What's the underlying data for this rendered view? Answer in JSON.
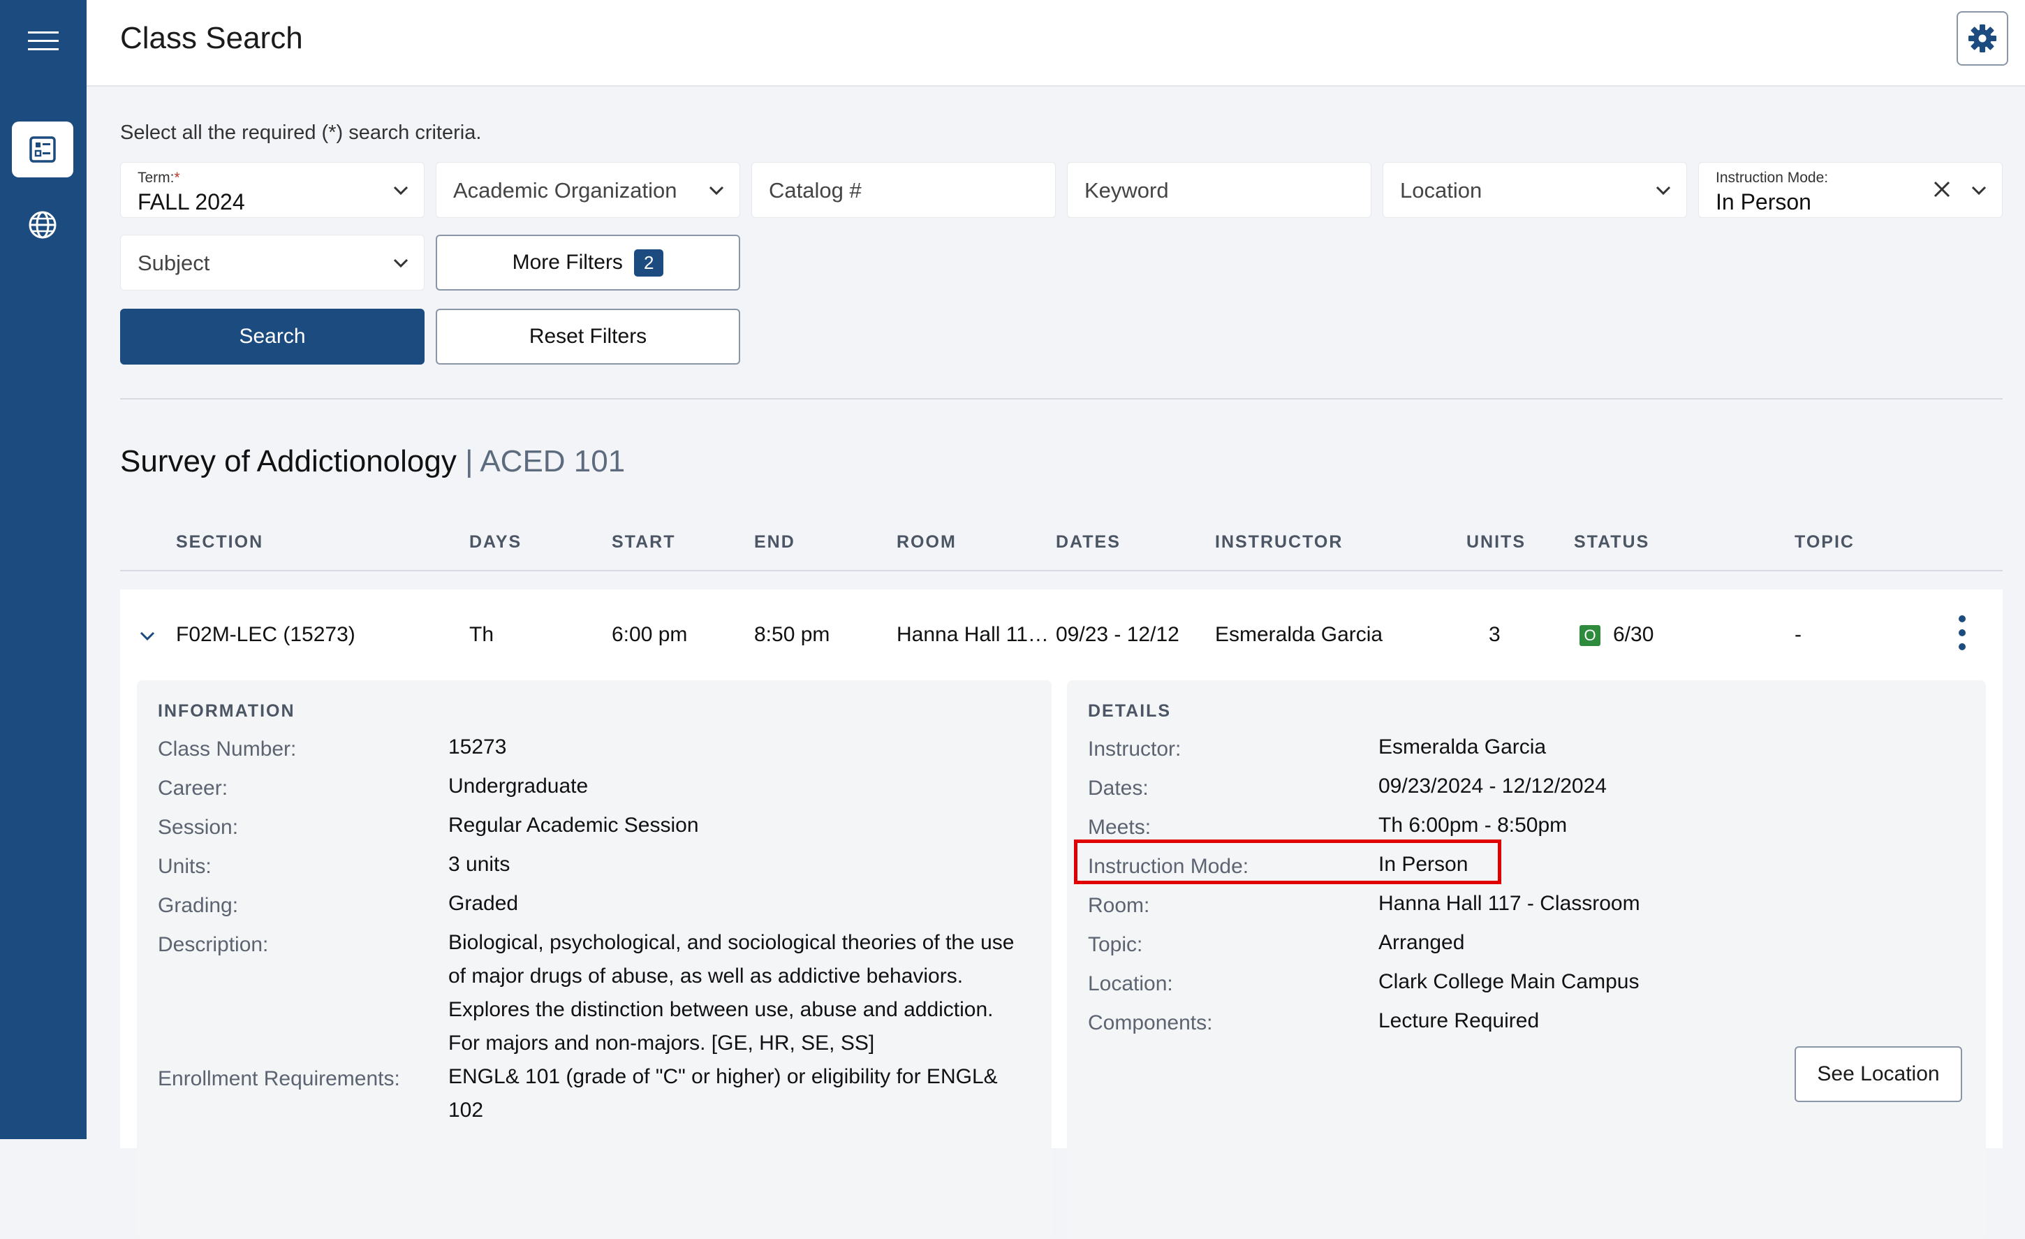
{
  "header": {
    "title": "Class Search"
  },
  "search": {
    "instructions": "Select all the required (*) search criteria.",
    "term": {
      "label": "Term:",
      "required_mark": "*",
      "value": "FALL 2024"
    },
    "academic_org": {
      "placeholder": "Academic Organization"
    },
    "catalog": {
      "placeholder": "Catalog #"
    },
    "keyword": {
      "placeholder": "Keyword"
    },
    "location": {
      "placeholder": "Location"
    },
    "instruction_mode": {
      "label": "Instruction Mode:",
      "value": "In Person"
    },
    "subject": {
      "placeholder": "Subject"
    },
    "more_filters": {
      "label": "More Filters",
      "count": "2"
    },
    "search_button": "Search",
    "reset_button": "Reset Filters"
  },
  "course": {
    "title": "Survey of Addictionology",
    "separator": "|",
    "code": "ACED 101"
  },
  "columns": [
    "SECTION",
    "DAYS",
    "START",
    "END",
    "ROOM",
    "DATES",
    "INSTRUCTOR",
    "UNITS",
    "STATUS",
    "TOPIC"
  ],
  "section_row": {
    "section": "F02M-LEC (15273)",
    "days": "Th",
    "start": "6:00 pm",
    "end": "8:50 pm",
    "room": "Hanna Hall 11…",
    "dates": "09/23 - 12/12",
    "instructor": "Esmeralda Garcia",
    "units": "3",
    "status_badge": "O",
    "status": "6/30",
    "topic": "-"
  },
  "information": {
    "title": "INFORMATION",
    "class_number": {
      "label": "Class Number:",
      "value": "15273"
    },
    "career": {
      "label": "Career:",
      "value": "Undergraduate"
    },
    "session": {
      "label": "Session:",
      "value": "Regular Academic Session"
    },
    "units": {
      "label": "Units:",
      "value": "3 units"
    },
    "grading": {
      "label": "Grading:",
      "value": "Graded"
    },
    "description": {
      "label": "Description:",
      "lines": [
        "Biological, psychological, and sociological theories of the use",
        "of major drugs of abuse, as well as addictive behaviors.",
        "Explores the distinction between use, abuse and addiction.",
        "For majors and non-majors. [GE, HR, SE, SS]"
      ]
    },
    "enrollment_requirements": {
      "label": "Enrollment Requirements:",
      "lines": [
        "ENGL& 101 (grade of \"C\" or higher) or eligibility for ENGL&",
        "102"
      ]
    }
  },
  "details": {
    "title": "DETAILS",
    "instructor": {
      "label": "Instructor:",
      "value": "Esmeralda Garcia"
    },
    "dates": {
      "label": "Dates:",
      "value": "09/23/2024 - 12/12/2024"
    },
    "meets": {
      "label": "Meets:",
      "value": "Th 6:00pm - 8:50pm"
    },
    "instruction_mode": {
      "label": "Instruction Mode:",
      "value": "In Person"
    },
    "room": {
      "label": "Room:",
      "value": "Hanna Hall 117 - Classroom"
    },
    "topic": {
      "label": "Topic:",
      "value": "Arranged"
    },
    "location": {
      "label": "Location:",
      "value": "Clark College Main Campus"
    },
    "components": {
      "label": "Components:",
      "value": "Lecture Required"
    },
    "see_location_button": "See Location"
  },
  "colors": {
    "brand": "#1c4b80",
    "open_status": "#2e8b3e",
    "highlight": "#e00000"
  }
}
